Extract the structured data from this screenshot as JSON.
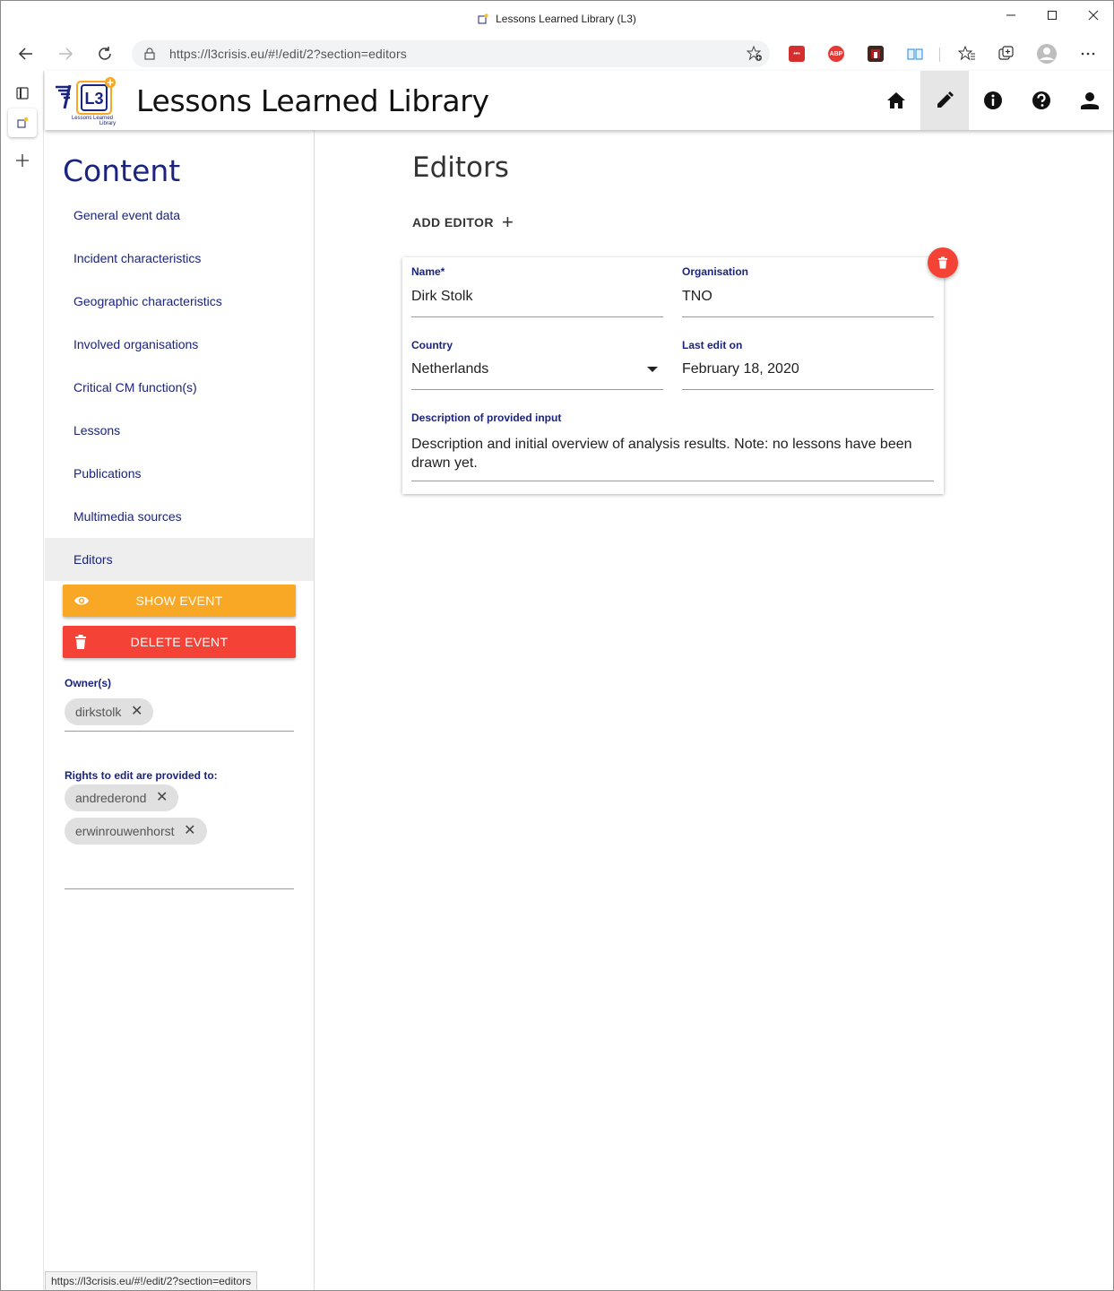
{
  "browser": {
    "window_title": "Lessons Learned Library (L3)",
    "url": "https://l3crisis.eu/#!/edit/2?section=editors",
    "status_url": "https://l3crisis.eu/#!/edit/2?section=editors",
    "extensions": [
      {
        "name": "password-manager-icon",
        "label": "•••",
        "color": "#d32f2f"
      },
      {
        "name": "adblock-plus-icon",
        "label": "ABP",
        "color": "#e53935"
      },
      {
        "name": "extension-icon",
        "label": "",
        "color": "#b71c1c"
      },
      {
        "name": "reader-icon",
        "label": "",
        "color": "#1e88e5"
      }
    ]
  },
  "app": {
    "title": "Lessons Learned Library",
    "logo_text": "L3",
    "logo_sub": "Lessons Learned Library"
  },
  "sidebar": {
    "title": "Content",
    "items": [
      {
        "label": "General event data"
      },
      {
        "label": "Incident characteristics"
      },
      {
        "label": "Geographic characteristics"
      },
      {
        "label": "Involved organisations"
      },
      {
        "label": "Critical CM function(s)"
      },
      {
        "label": "Lessons"
      },
      {
        "label": "Publications"
      },
      {
        "label": "Multimedia sources"
      },
      {
        "label": "Editors",
        "active": true
      }
    ],
    "show_event_label": "SHOW EVENT",
    "delete_event_label": "DELETE EVENT",
    "owners_label": "Owner(s)",
    "owners": [
      "dirkstolk"
    ],
    "rights_label": "Rights to edit are provided to:",
    "rights": [
      "andrederond",
      "erwinrouwenhorst"
    ]
  },
  "main": {
    "title": "Editors",
    "add_editor_label": "ADD EDITOR",
    "editor": {
      "name_label": "Name*",
      "name": "Dirk Stolk",
      "organisation_label": "Organisation",
      "organisation": "TNO",
      "country_label": "Country",
      "country": "Netherlands",
      "last_edit_label": "Last edit on",
      "last_edit": "February 18, 2020",
      "description_label": "Description of provided input",
      "description": "Description and initial overview of analysis results. Note: no lessons have been drawn yet."
    }
  },
  "colors": {
    "accent": "#1a237e",
    "show_event": "#f9a825",
    "delete": "#f44336"
  }
}
